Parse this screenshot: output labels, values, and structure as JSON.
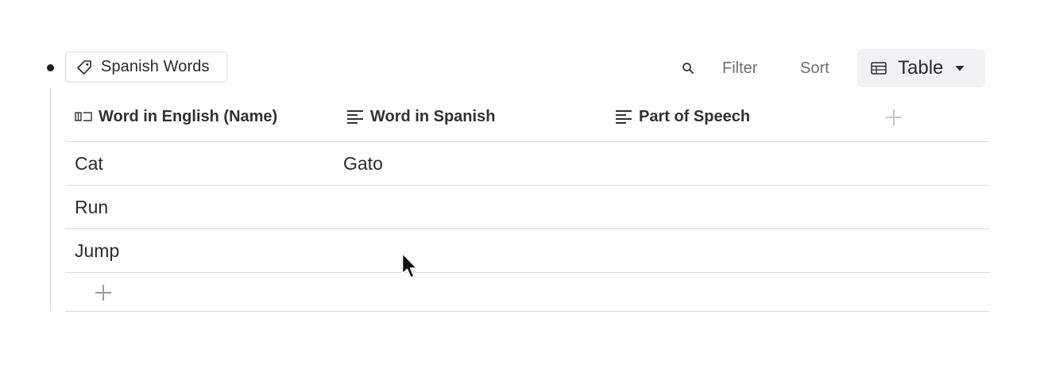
{
  "collection": {
    "tag_label": "Spanish Words",
    "tag_icon": "tag-icon"
  },
  "toolbar": {
    "search_icon": "search-icon",
    "filter_label": "Filter",
    "sort_label": "Sort",
    "view_label": "Table",
    "view_icon": "table-icon",
    "view_dropdown_icon": "caret-down-icon"
  },
  "table": {
    "columns": [
      {
        "label": "Word in English (Name)",
        "icon": "name-field-icon"
      },
      {
        "label": "Word in Spanish",
        "icon": "text-field-icon"
      },
      {
        "label": "Part of Speech",
        "icon": "text-field-icon"
      }
    ],
    "add_column_icon": "plus-icon",
    "rows": [
      {
        "english": "Cat",
        "spanish": "Gato",
        "part": ""
      },
      {
        "english": "Run",
        "spanish": "",
        "part": ""
      },
      {
        "english": "Jump",
        "spanish": "",
        "part": ""
      }
    ],
    "add_row_icon": "plus-icon"
  },
  "colors": {
    "text": "#2a2a30",
    "muted": "#6d6d76",
    "border": "#d9d9dd",
    "button_bg": "#f2f2f6",
    "plus": "#b8b8c0"
  }
}
